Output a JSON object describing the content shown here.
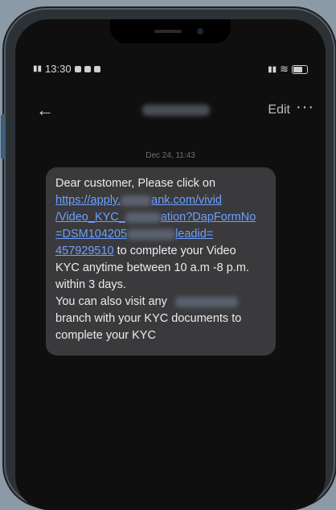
{
  "status_bar": {
    "time": "13:30"
  },
  "app_bar": {
    "edit_label": "Edit",
    "more_icon": "more-horizontal-icon",
    "back_icon": "back-arrow-icon"
  },
  "conversation": {
    "date_label": "Dec 24, 11:43",
    "message": {
      "line1": "Dear customer, Please click on",
      "link1": "https://apply.",
      "link1b": "ank.com/vivid",
      "link2a": "/Video_KYC_",
      "link2b": "ation?DapFormNo",
      "link3a": "=DSM104205",
      "link3b": "leadid=",
      "link4": "457929510",
      "line4_tail": " to complete your Video",
      "line5": "KYC anytime between 10 a.m -8 p.m.",
      "line6": "within 3 days.",
      "line7": "You can also visit any",
      "line8": "branch with your KYC documents to",
      "line9": "complete your KYC"
    }
  },
  "colors": {
    "bubble": "#3a3a3c",
    "link": "#6ea0ff",
    "screen_bg": "#0f0f0f"
  }
}
